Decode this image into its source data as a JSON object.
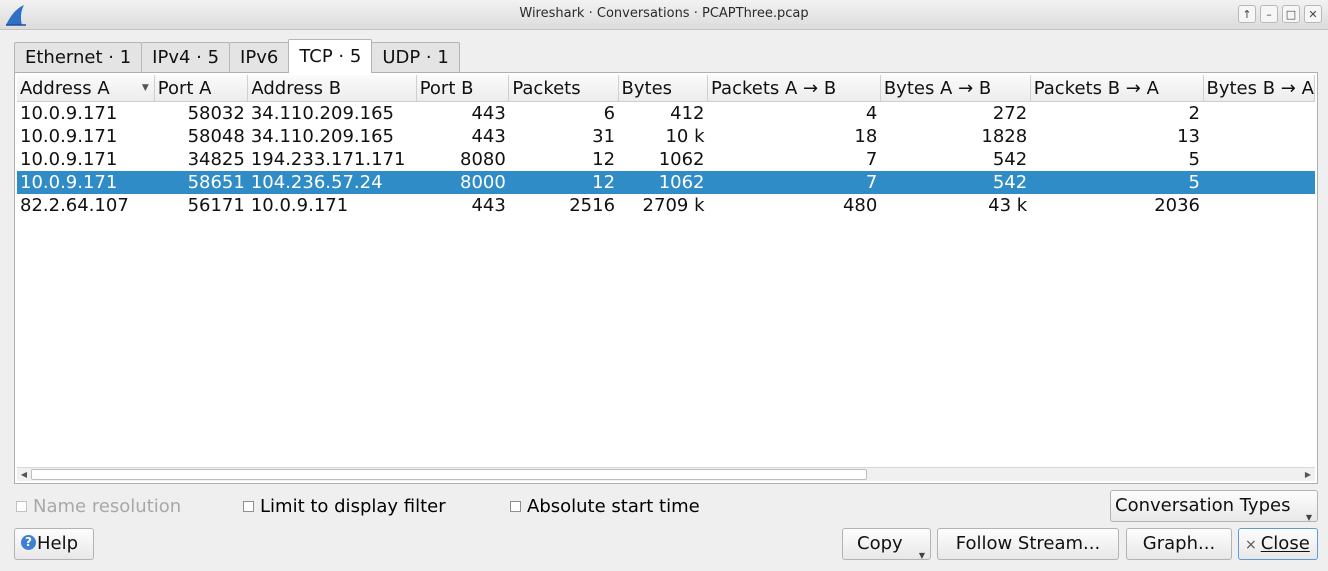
{
  "window": {
    "title": "Wireshark · Conversations · PCAPThree.pcap",
    "controls": [
      "↑",
      "–",
      "□",
      "✕"
    ]
  },
  "tabs": [
    {
      "label": "Ethernet · 1",
      "active": false
    },
    {
      "label": "IPv4 · 5",
      "active": false
    },
    {
      "label": "IPv6",
      "active": false
    },
    {
      "label": "TCP · 5",
      "active": true
    },
    {
      "label": "UDP · 1",
      "active": false
    }
  ],
  "table": {
    "columns": [
      "Address A",
      "Port A",
      "Address B",
      "Port B",
      "Packets",
      "Bytes",
      "Packets A → B",
      "Bytes A → B",
      "Packets B → A",
      "Bytes B → A"
    ],
    "rows": [
      {
        "cells": [
          "10.0.9.171",
          "58032",
          "34.110.209.165",
          "443",
          "6",
          "412",
          "4",
          "272",
          "2",
          ""
        ],
        "selected": false
      },
      {
        "cells": [
          "10.0.9.171",
          "58048",
          "34.110.209.165",
          "443",
          "31",
          "10 k",
          "18",
          "1828",
          "13",
          ""
        ],
        "selected": false
      },
      {
        "cells": [
          "10.0.9.171",
          "34825",
          "194.233.171.171",
          "8080",
          "12",
          "1062",
          "7",
          "542",
          "5",
          ""
        ],
        "selected": false
      },
      {
        "cells": [
          "10.0.9.171",
          "58651",
          "104.236.57.24",
          "8000",
          "12",
          "1062",
          "7",
          "542",
          "5",
          ""
        ],
        "selected": true
      },
      {
        "cells": [
          "82.2.64.107",
          "56171",
          "10.0.9.171",
          "443",
          "2516",
          "2709 k",
          "480",
          "43 k",
          "2036",
          ""
        ],
        "selected": false
      }
    ]
  },
  "options": {
    "name_resolution": "Name resolution",
    "limit_display_filter": "Limit to display filter",
    "absolute_start_time": "Absolute start time"
  },
  "buttons": {
    "conversation_types": "Conversation Types",
    "help": "Help",
    "copy": "Copy",
    "follow_stream": "Follow Stream...",
    "graph": "Graph...",
    "close": "Close"
  },
  "colors": {
    "selection": "#308cc6",
    "disabled_text": "#a8a8a8"
  }
}
